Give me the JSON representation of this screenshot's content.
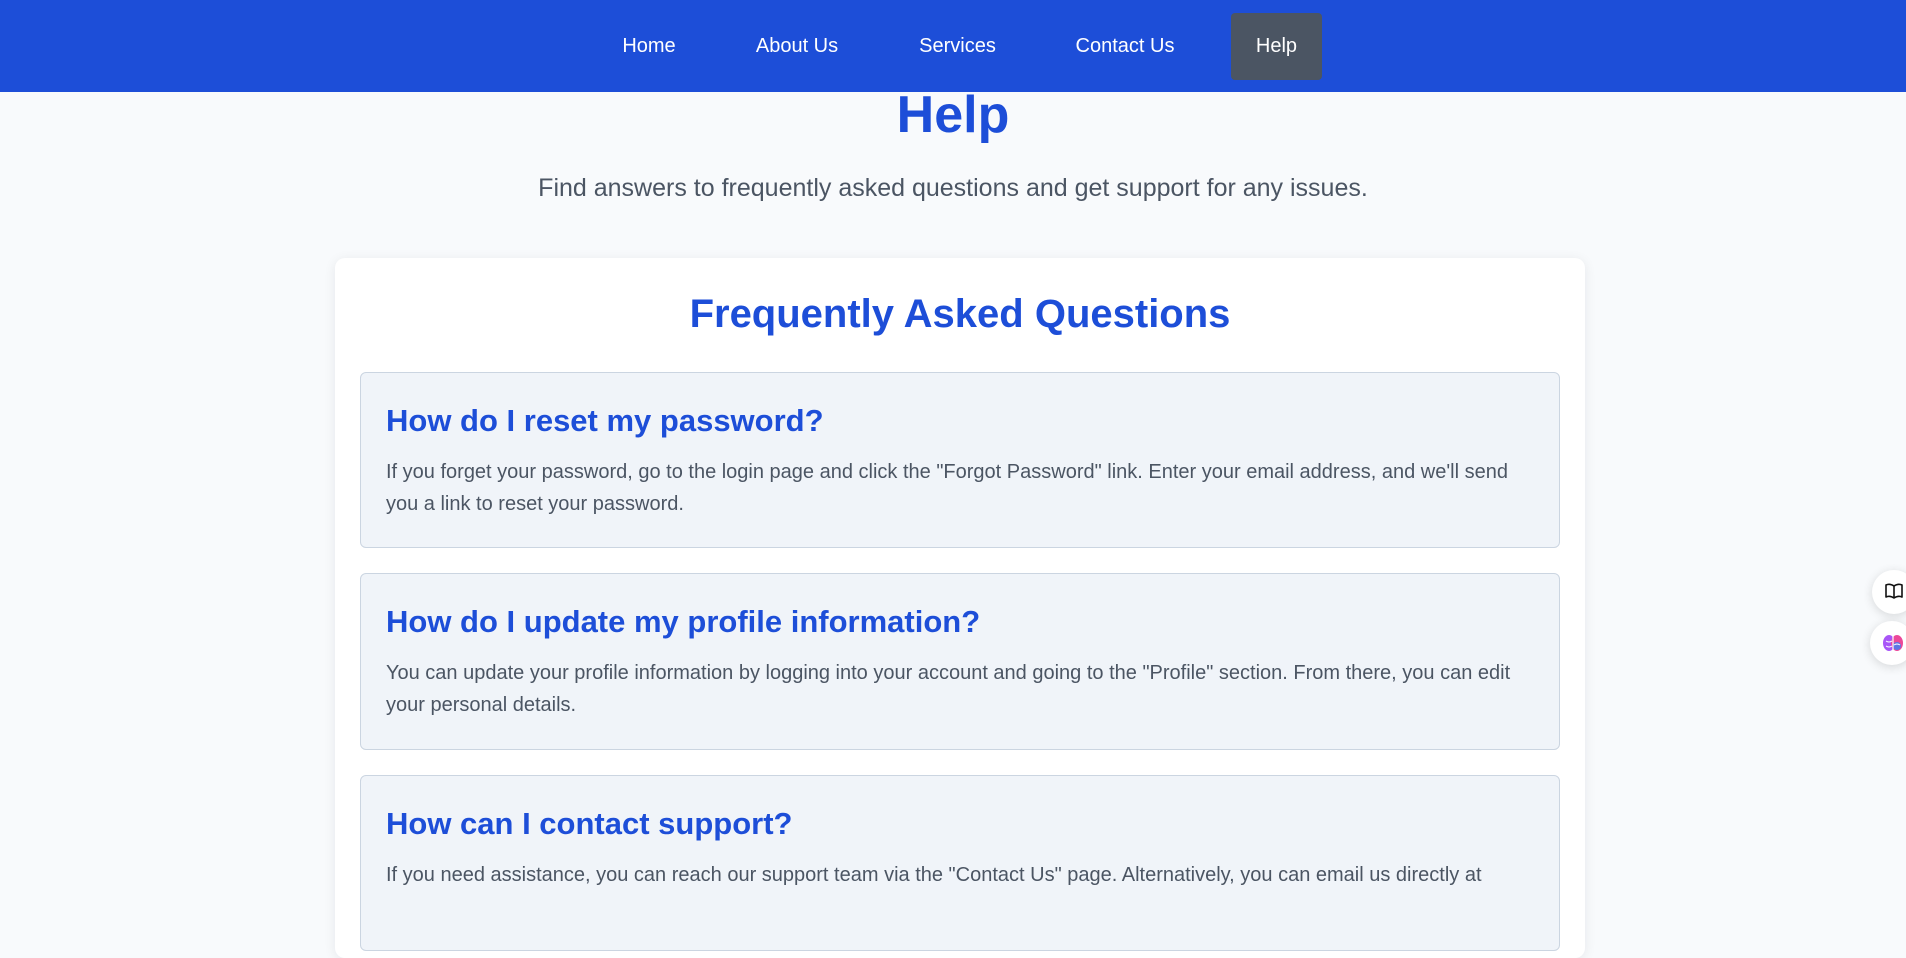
{
  "nav": {
    "items": [
      {
        "label": "Home"
      },
      {
        "label": "About Us"
      },
      {
        "label": "Services"
      },
      {
        "label": "Contact Us"
      },
      {
        "label": "Help",
        "active": true
      }
    ]
  },
  "hero": {
    "title": "Help",
    "subtitle": "Find answers to frequently asked questions and get support for any issues."
  },
  "faq": {
    "heading": "Frequently Asked Questions",
    "items": [
      {
        "question": "How do I reset my password?",
        "answer": "If you forget your password, go to the login page and click the \"Forgot Password\" link. Enter your email address, and we'll send you a link to reset your password."
      },
      {
        "question": "How do I update my profile information?",
        "answer": "You can update your profile information by logging into your account and going to the \"Profile\" section. From there, you can edit your personal details."
      },
      {
        "question": "How can I contact support?",
        "answer": "If you need assistance, you can reach our support team via the \"Contact Us\" page. Alternatively, you can email us directly at"
      }
    ]
  },
  "floating": {
    "icons": [
      "book-icon",
      "brain-icon"
    ]
  },
  "colors": {
    "primary": "#1d4ed8",
    "nav_active": "#4b5563",
    "page_bg": "#f8fafc",
    "faq_item_bg": "#f0f4f9",
    "text_muted": "#4b5563"
  }
}
